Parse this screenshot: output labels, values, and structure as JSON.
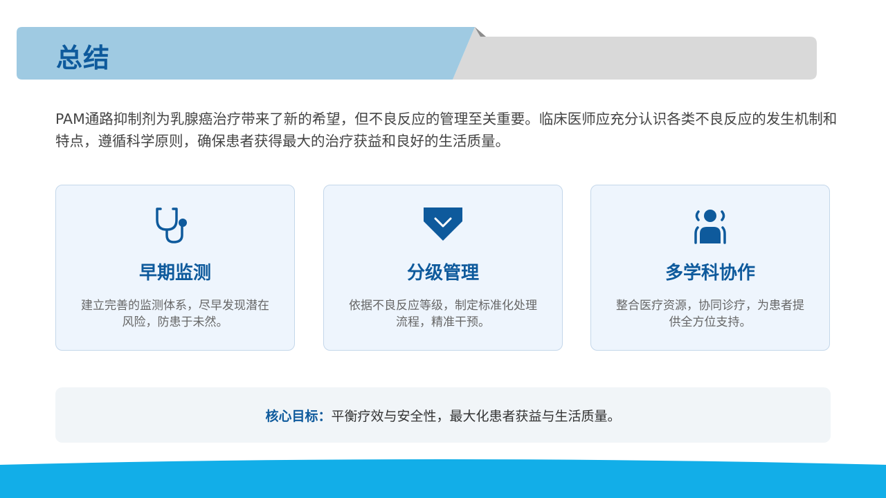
{
  "title": "总结",
  "intro": "PAM通路抑制剂为乳腺癌治疗带来了新的希望，但不良反应的管理至关重要。临床医师应充分认识各类不良反应的发生机制和特点，遵循科学原则，确保患者获得最大的治疗获益和良好的生活质量。",
  "cards": [
    {
      "icon": "stethoscope-icon",
      "title": "早期监测",
      "desc": "建立完善的监测体系，尽早发现潜在风险，防患于未然。"
    },
    {
      "icon": "diamond-check-icon",
      "title": "分级管理",
      "desc": "依据不良反应等级，制定标准化处理流程，精准干预。"
    },
    {
      "icon": "team-user-icon",
      "title": "多学科协作",
      "desc": "整合医疗资源，协同诊疗，为患者提供全方位支持。"
    }
  ],
  "goal": {
    "label": "核心目标：",
    "text": "平衡疗效与安全性，最大化患者获益与生活质量。"
  },
  "colors": {
    "accent": "#0e5a9c",
    "title_band": "#9fcae2",
    "gray_band": "#d9d9d9",
    "wave": "#12aee8",
    "card_bg": "#eef5fd"
  }
}
